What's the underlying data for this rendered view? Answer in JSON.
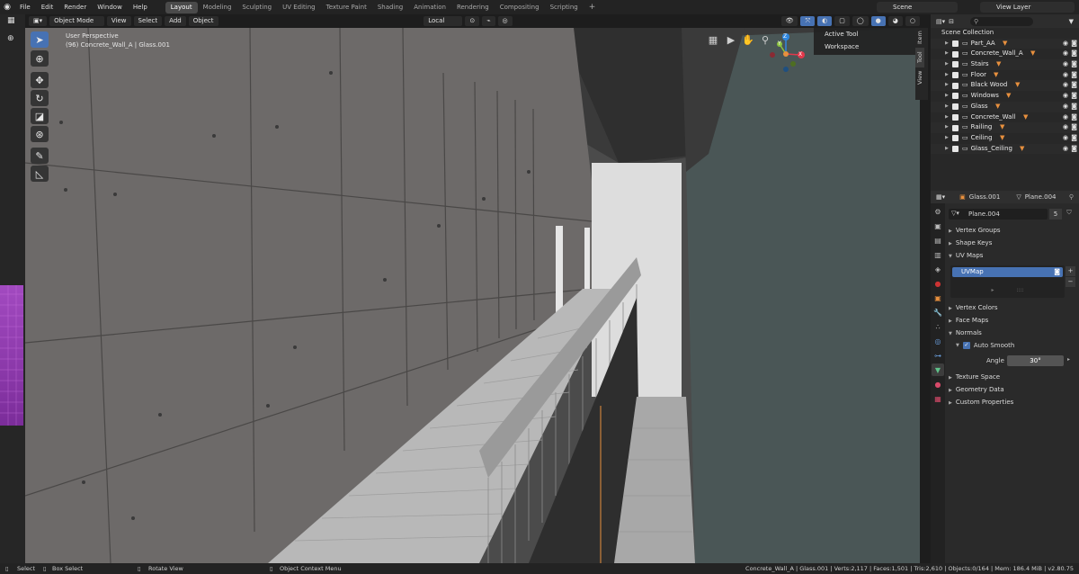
{
  "topbar": {
    "menus": [
      "File",
      "Edit",
      "Render",
      "Window",
      "Help"
    ],
    "workspaces": [
      "Layout",
      "Modeling",
      "Sculpting",
      "UV Editing",
      "Texture Paint",
      "Shading",
      "Animation",
      "Rendering",
      "Compositing",
      "Scripting"
    ],
    "active_workspace": "Layout",
    "add_tab": "+",
    "scene": "Scene",
    "view_layer": "View Layer"
  },
  "viewport_header": {
    "mode": "Object Mode",
    "menus": [
      "View",
      "Select",
      "Add",
      "Object"
    ],
    "orientation": "Local"
  },
  "viewport": {
    "view_name": "User Perspective",
    "object_info": "(96) Concrete_Wall_A | Glass.001"
  },
  "gizmo": {
    "x": "X",
    "y": "Y",
    "z": "Z"
  },
  "npanel": {
    "items": [
      "Active Tool",
      "Workspace"
    ],
    "tabs": [
      "Item",
      "Tool",
      "View"
    ]
  },
  "outliner": {
    "root": "Scene Collection",
    "collections": [
      "Part_AA",
      "Concrete_Wall_A",
      "Stairs",
      "Floor",
      "Black Wood",
      "Windows",
      "Glass",
      "Concrete_Wall",
      "Railing",
      "Ceiling",
      "Glass_Ceiling"
    ],
    "filter_counts": [
      "2",
      "4",
      "",
      "",
      "",
      "",
      "",
      "",
      "",
      "",
      ""
    ]
  },
  "properties": {
    "object_name": "Glass.001",
    "data_name": "Plane.004",
    "mesh_field": "Plane.004",
    "users": "5",
    "sections": [
      "Vertex Groups",
      "Shape Keys",
      "UV Maps",
      "Vertex Colors",
      "Face Maps",
      "Normals",
      "Texture Space",
      "Geometry Data",
      "Custom Properties"
    ],
    "uvmap": "UVMap",
    "auto_smooth": "Auto Smooth",
    "angle_label": "Angle",
    "angle_value": "30°"
  },
  "statusbar": {
    "select": "Select",
    "box_select": "Box Select",
    "rotate": "Rotate View",
    "context": "Object Context Menu",
    "stats": "Concrete_Wall_A | Glass.001 | Verts:2,117 | Faces:1,501 | Tris:2,610 | Objects:0/164 | Mem: 186.4 MiB | v2.80.75"
  },
  "colors": {
    "accent": "#4772b3",
    "object_orange": "#e8903e",
    "gizmo_x": "#e2384b",
    "gizmo_y": "#8cc43e",
    "gizmo_z": "#2f87e0"
  }
}
